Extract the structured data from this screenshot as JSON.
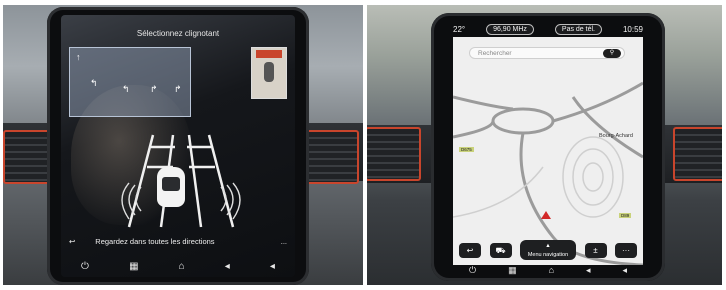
{
  "left": {
    "title": "Sélectionnez clignotant",
    "message": "Regardez dans toutes les directions",
    "more_label": "...",
    "back_glyph": "↩",
    "nav_icons": [
      "power-icon",
      "grid-icon",
      "home-icon",
      "volume-down-icon",
      "volume-up-icon"
    ]
  },
  "right": {
    "temperature": "22°",
    "radio": "96,90 MHz",
    "phone_status": "Pas de tél.",
    "clock": "10:59",
    "search_placeholder": "Rechercher",
    "place_label": "Bourg-Achard",
    "road_tag_1": "D675",
    "road_tag_2": "D89",
    "menu_label": "Menu navigation",
    "nav_icons": [
      "power-icon",
      "grid-icon",
      "home-icon",
      "volume-down-icon",
      "volume-up-icon"
    ],
    "accent_color": "#d22828"
  }
}
